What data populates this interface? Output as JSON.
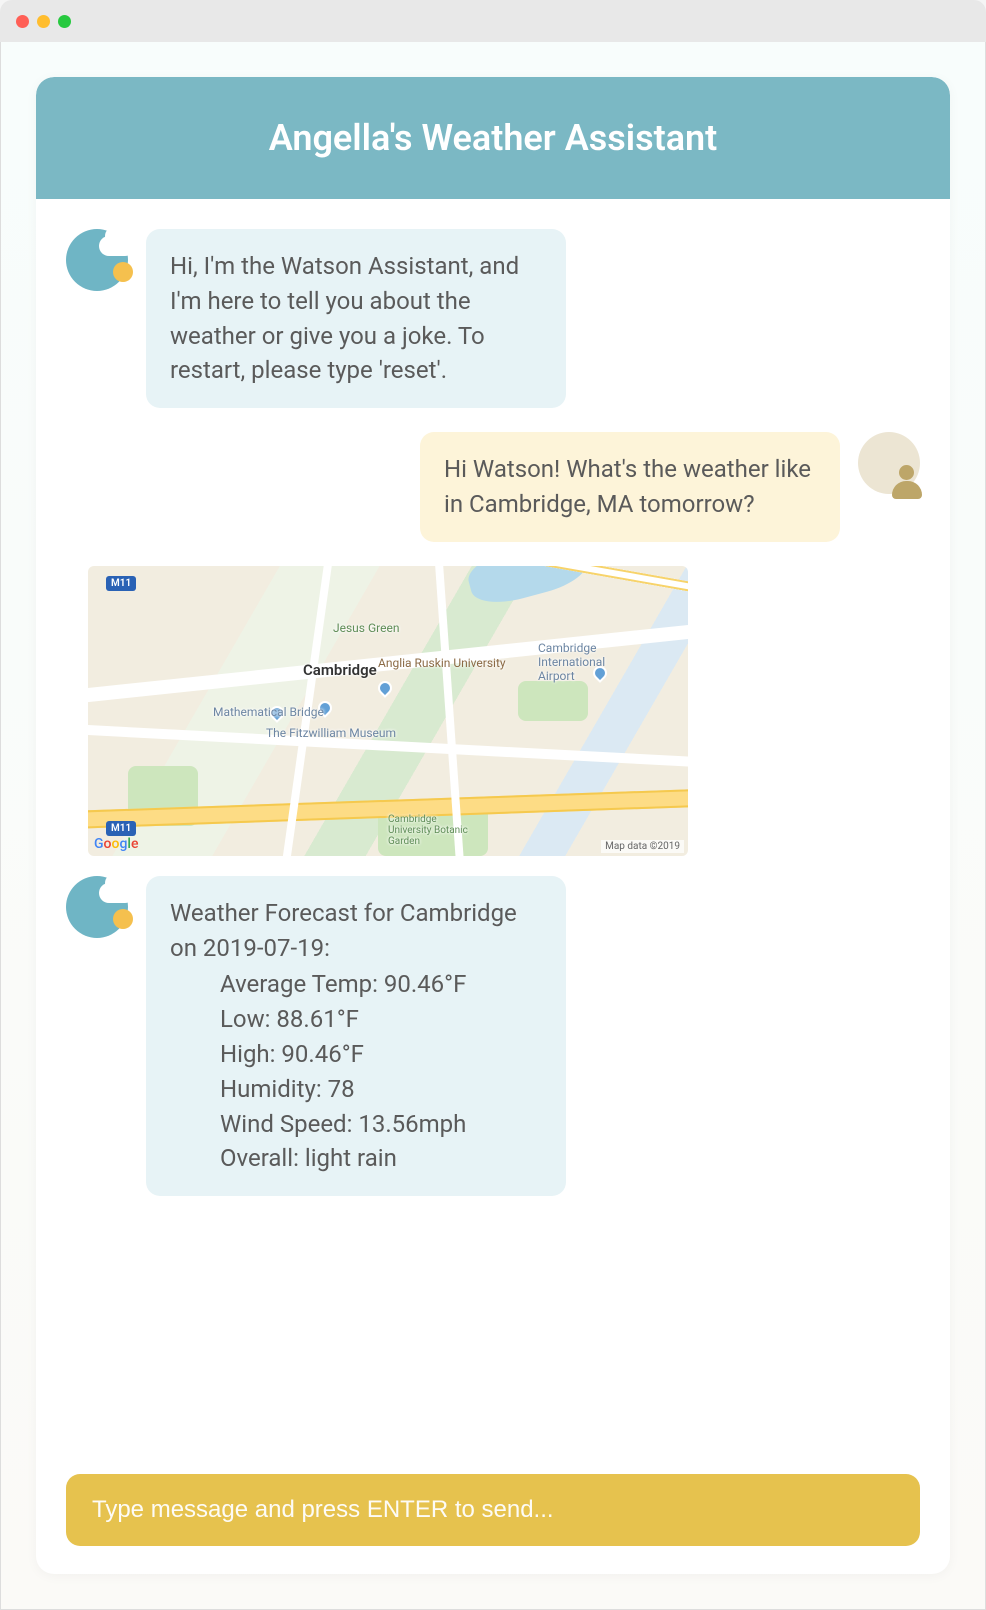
{
  "header": {
    "title": "Angella's Weather Assistant"
  },
  "messages": {
    "bot_intro": "Hi, I'm the Watson Assistant, and I'm here to tell you about the weather or give you a joke. To restart, please type 'reset'.",
    "user_query": "Hi Watson! What's the weather like in Cambridge, MA tomorrow?",
    "forecast_header": "Weather Forecast for Cambridge on 2019-07-19:",
    "forecast": {
      "avg_temp": "Average Temp: 90.46°F",
      "low": "Low: 88.61°F",
      "high": "High: 90.46°F",
      "humidity": "Humidity: 78",
      "wind": "Wind Speed: 13.56mph",
      "overall": "Overall: light rain"
    }
  },
  "map": {
    "center_label": "Cambridge",
    "labels": {
      "anglia": "Anglia Ruskin University",
      "fitzwilliam": "The Fitzwilliam Museum",
      "math_bridge": "Mathematical Bridge",
      "jesus_green": "Jesus Green",
      "airport": "Cambridge International Airport",
      "botanic": "Cambridge University Botanic Garden"
    },
    "highway_shield": "M11",
    "logo": "Google",
    "attribution": "Map data ©2019"
  },
  "input": {
    "placeholder": "Type message and press ENTER to send..."
  }
}
